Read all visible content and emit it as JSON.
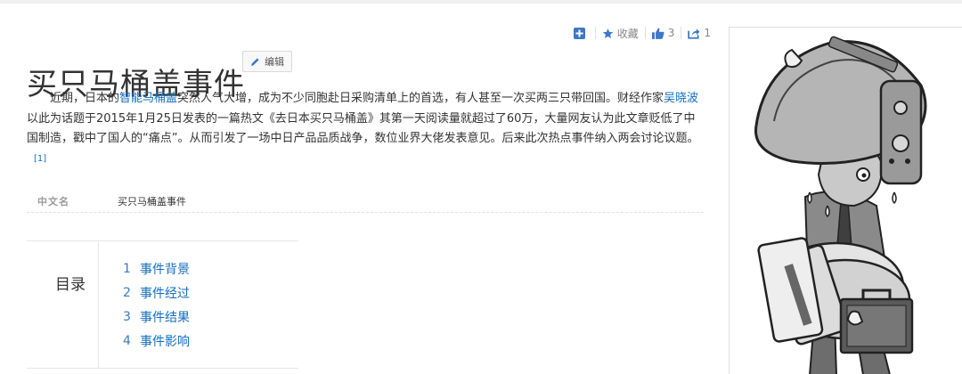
{
  "toolbar": {
    "favorite_label": "收藏",
    "like_count": "3",
    "share_count": "1",
    "icons": [
      "add-icon",
      "star-icon",
      "thumbs-up-icon",
      "share-icon"
    ]
  },
  "title": "买只马桶盖事件",
  "edit_label": "编辑",
  "summary": {
    "p1": "近期，日本的",
    "link1": "智能马桶盖",
    "p2": "突然人气大增，成为不少同胞赴日采购清单上的首选，有人甚至一次买两三只带回国。财经作家",
    "link2": "吴晓波",
    "p3": "以此为话题于2015年1月25日发表的一篇热文《去日本买只马桶盖》其第一天阅读量就超过了60万，大量网友认为此文章贬低了中国制造，戳中了国人的“痛点”。从而引发了一场中日产品品质战争，数位业界大佬发表意见。后来此次热点事件纳入两会讨论议题。",
    "ref": "[1]"
  },
  "basic_info": {
    "key": "中文名",
    "value": "买只马桶盖事件"
  },
  "catalog": {
    "title": "目录",
    "items": [
      {
        "num": "1",
        "label": "事件背景"
      },
      {
        "num": "2",
        "label": "事件经过"
      },
      {
        "num": "3",
        "label": "事件结果"
      },
      {
        "num": "4",
        "label": "事件影响"
      }
    ]
  },
  "colors": {
    "link": "#136ec2",
    "toolbar_blue": "#3c78c8",
    "text": "#333333"
  }
}
